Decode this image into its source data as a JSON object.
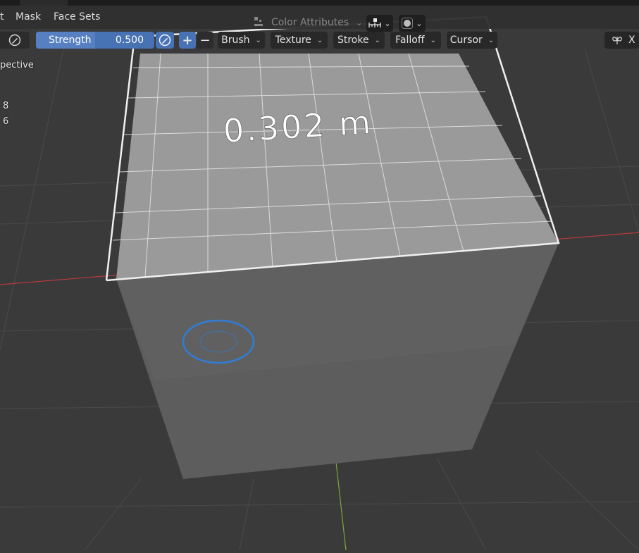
{
  "header": {
    "menu": [
      {
        "id": "select",
        "label": "t"
      },
      {
        "id": "mask",
        "label": "Mask"
      },
      {
        "id": "face_sets",
        "label": "Face Sets"
      }
    ],
    "color_attributes": "Color Attributes"
  },
  "tool_settings": {
    "strength": {
      "label": "Strength",
      "value": "0.500",
      "fill_fraction": 0.5
    },
    "plus": "+",
    "minus": "−",
    "dropdowns": [
      "Brush",
      "Texture",
      "Stroke",
      "Falloff",
      "Cursor"
    ],
    "right_label": "X"
  },
  "overlay": {
    "view_mode": "pective",
    "stat_1": "8",
    "stat_2": "6"
  },
  "viewport": {
    "measurement": "0.302 m"
  },
  "colors": {
    "accent": "#4772b3",
    "brush_ring": "#2f7dd6",
    "x_axis": "#b83a3a",
    "y_axis": "#7ca83a",
    "background": "#3a3a3a"
  }
}
